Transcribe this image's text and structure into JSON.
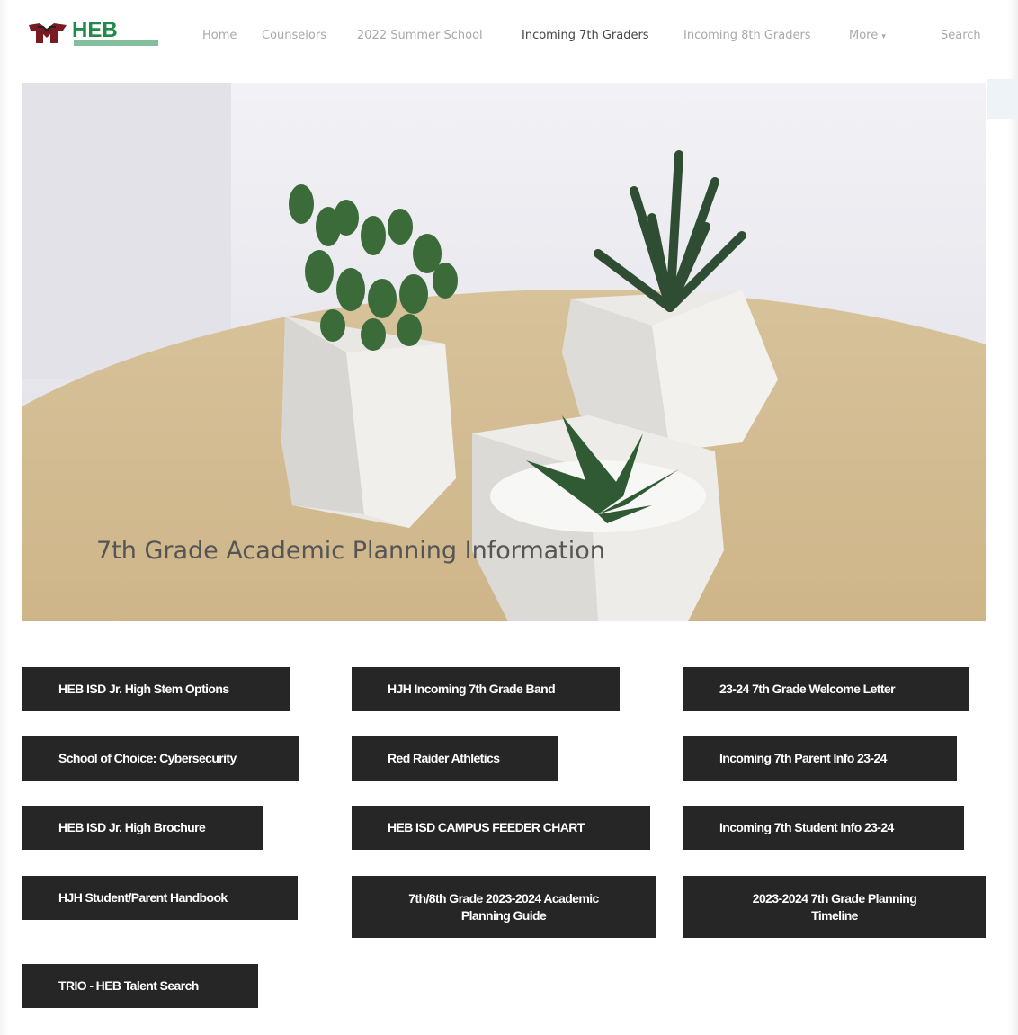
{
  "header": {
    "logo_text": "HEB",
    "nav": [
      {
        "label": "Home",
        "active": false
      },
      {
        "label": "Counselors",
        "active": false
      },
      {
        "label": "2022 Summer School",
        "active": false
      },
      {
        "label": "Incoming 7th Graders",
        "active": true
      },
      {
        "label": "Incoming 8th Graders",
        "active": false
      },
      {
        "label": "More",
        "active": false
      }
    ],
    "search_label": "Search"
  },
  "hero": {
    "title": "7th Grade Academic Planning Information"
  },
  "buttons": [
    {
      "label": "HEB ISD Jr. High Stem Options"
    },
    {
      "label": "HJH Incoming 7th Grade Band"
    },
    {
      "label": "23-24 7th Grade Welcome Letter"
    },
    {
      "label": "School of Choice: Cybersecurity"
    },
    {
      "label": "Red Raider Athletics"
    },
    {
      "label": "Incoming 7th Parent Info 23-24"
    },
    {
      "label": "HEB ISD Jr. High Brochure"
    },
    {
      "label": "HEB ISD CAMPUS FEEDER CHART"
    },
    {
      "label": "Incoming 7th Student Info 23-24"
    },
    {
      "label": "HJH Student/Parent Handbook"
    },
    {
      "label": "7th/8th Grade 2023-2024 Academic Planning Guide"
    },
    {
      "label": "2023-2024 7th Grade Planning Timeline"
    },
    {
      "label": "TRIO - HEB Talent Search"
    }
  ],
  "colors": {
    "button_bg": "#262626",
    "logo_green": "#1f8a4c",
    "logo_maroon": "#7a1a22",
    "nav_inactive": "#a9a9a9",
    "nav_active": "#444444"
  }
}
